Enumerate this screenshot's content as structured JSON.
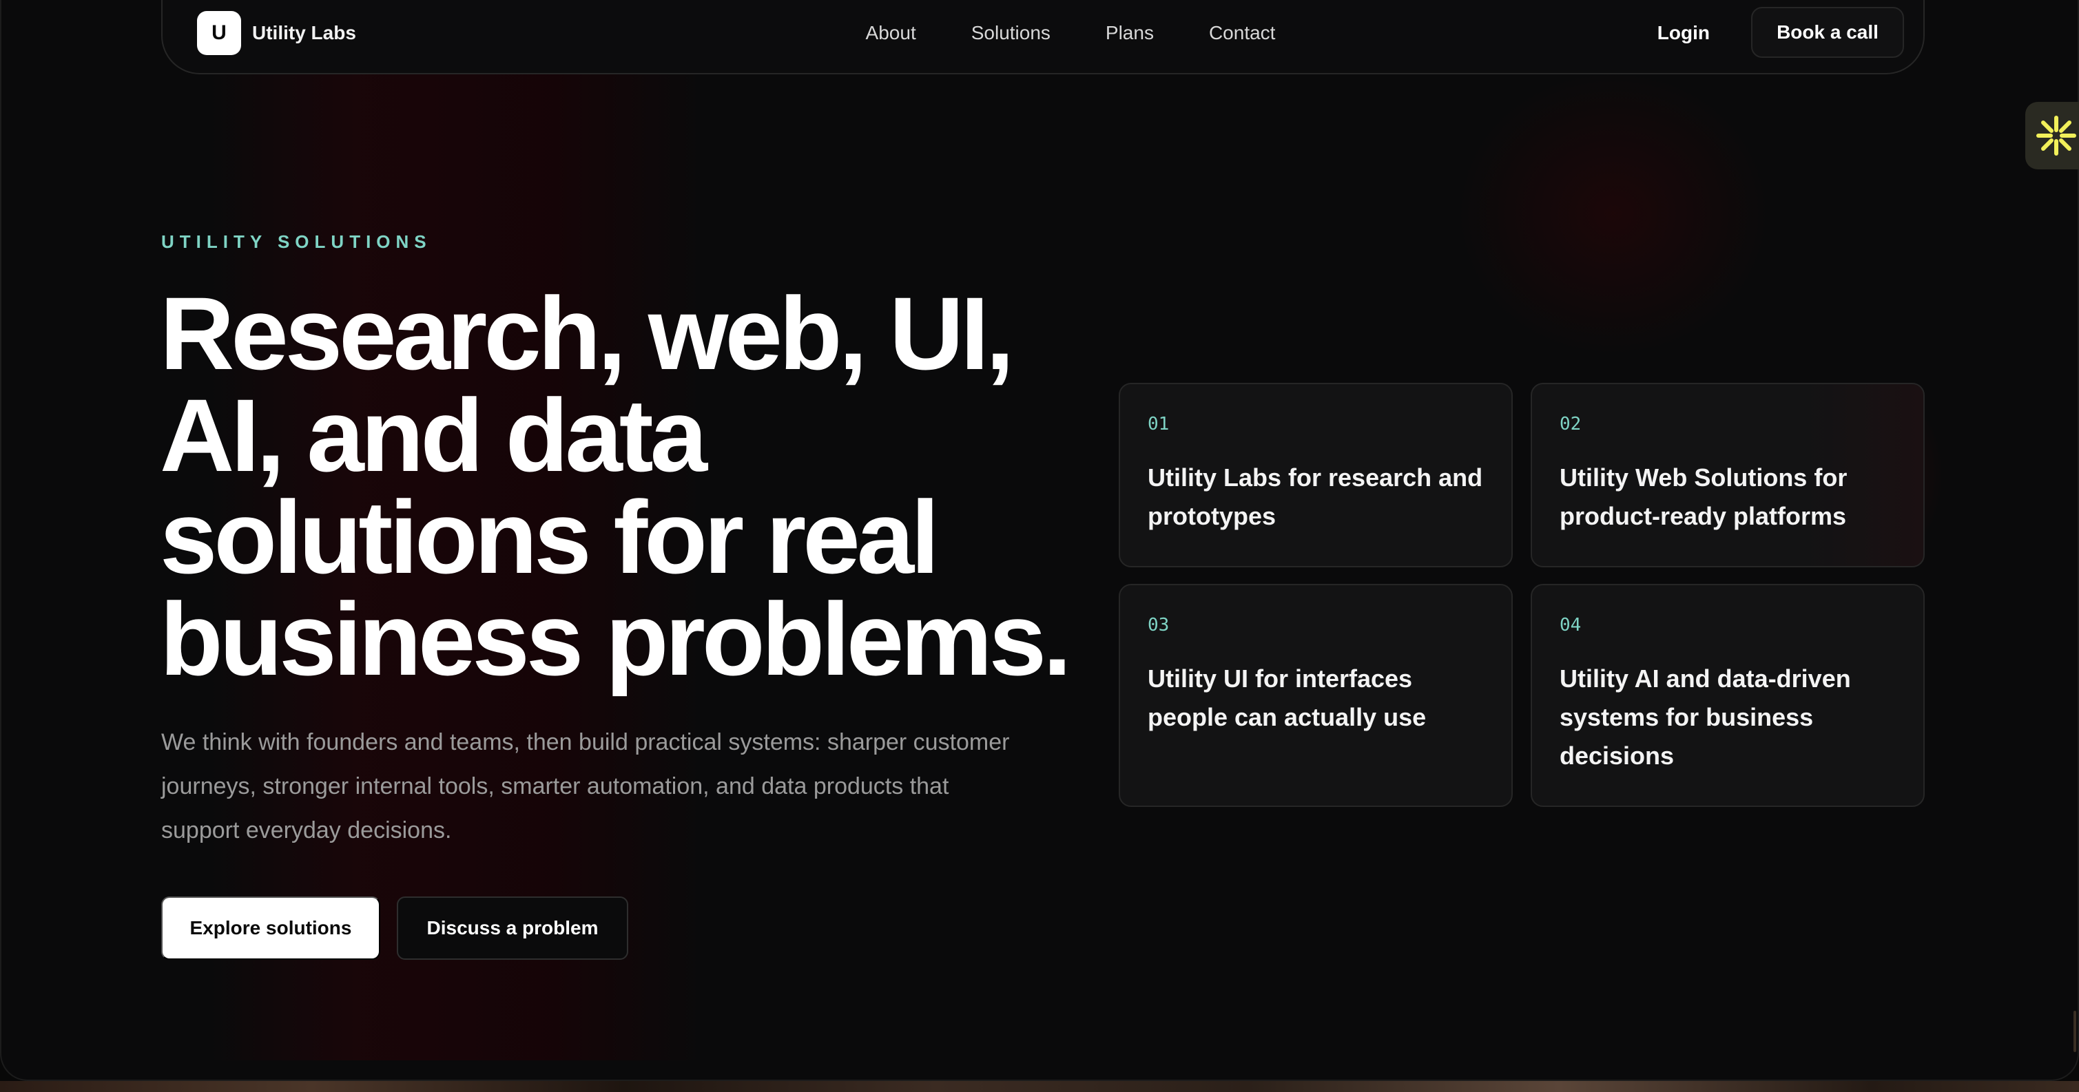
{
  "nav": {
    "logo_letter": "U",
    "brand": "Utility Labs",
    "links": [
      "About",
      "Solutions",
      "Plans",
      "Contact"
    ],
    "login": "Login",
    "cta": "Book a call"
  },
  "hero": {
    "eyebrow": "UTILITY SOLUTIONS",
    "headline_lines": [
      "Research, web, UI,",
      "AI, and data",
      "solutions for real",
      "business problems."
    ],
    "lead": "We think with founders and teams, then build practical systems: sharper customer journeys, stronger internal tools, smarter automation, and data products that support everyday decisions.",
    "primary_button": "Explore solutions",
    "secondary_button": "Discuss a problem"
  },
  "cards": [
    {
      "num": "01",
      "title": "Utility Labs for research and prototypes"
    },
    {
      "num": "02",
      "title": "Utility Web Solutions for product-ready platforms"
    },
    {
      "num": "03",
      "title": "Utility UI for interfaces people can actually use"
    },
    {
      "num": "04",
      "title": "Utility AI and data-driven systems for business decisions"
    }
  ],
  "colors": {
    "accent": "#7fd4c5",
    "background": "#0a0a0b",
    "widget_icon": "#f2f05a"
  },
  "icons": {
    "widget": "asterisk-burst-icon"
  }
}
